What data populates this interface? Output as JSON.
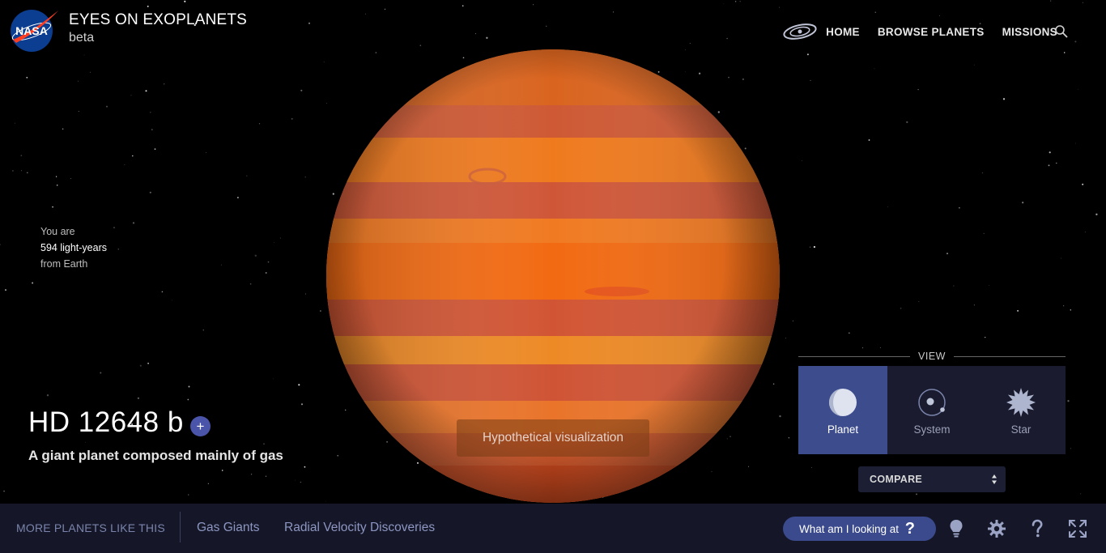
{
  "header": {
    "logo_text": "NASA",
    "title": "EYES ON EXOPLANETS",
    "subtitle": "beta"
  },
  "nav": {
    "items": [
      "HOME",
      "BROWSE PLANETS",
      "MISSIONS"
    ],
    "icons": [
      "galaxy-icon",
      "search-icon"
    ]
  },
  "distance": {
    "prefix": "You are",
    "value": "594 light-years",
    "suffix": "from Earth"
  },
  "planet": {
    "name": "HD 12648 b",
    "add_label": "+",
    "description": "A giant planet composed mainly of gas",
    "visualization_note": "Hypothetical visualization",
    "colors": {
      "base": "#e8651a",
      "band_dark": "#c4503a",
      "band_light": "#f28a2a"
    }
  },
  "view": {
    "label": "VIEW",
    "options": [
      {
        "label": "Planet",
        "icon": "planet-icon",
        "active": true
      },
      {
        "label": "System",
        "icon": "system-icon",
        "active": false
      },
      {
        "label": "Star",
        "icon": "star-icon",
        "active": false
      }
    ]
  },
  "compare": {
    "label": "COMPARE"
  },
  "bottom": {
    "more_label": "MORE PLANETS LIKE THIS",
    "categories": [
      "Gas Giants",
      "Radial Velocity Discoveries"
    ],
    "looking_label": "What am I looking at",
    "looking_q": "?",
    "tools": [
      "lightbulb-icon",
      "gear-icon",
      "help-icon",
      "fullscreen-icon"
    ]
  },
  "colors": {
    "accent": "#3c4c8c",
    "bar_bg": "#151729",
    "link": "#8c96c0"
  }
}
